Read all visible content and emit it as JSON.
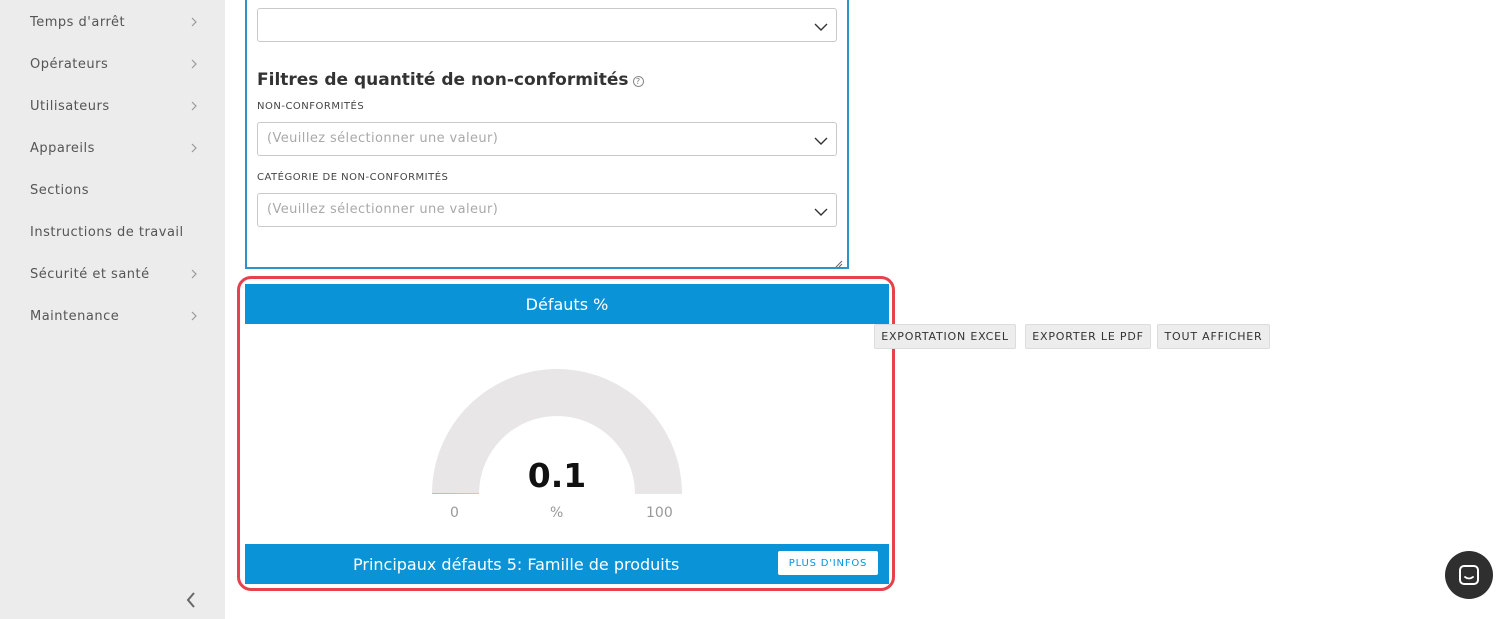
{
  "sidebar": {
    "items": [
      {
        "label": "Temps d'arrêt",
        "chevron": true
      },
      {
        "label": "Opérateurs",
        "chevron": true
      },
      {
        "label": "Utilisateurs",
        "chevron": true
      },
      {
        "label": "Appareils",
        "chevron": true
      },
      {
        "label": "Sections",
        "chevron": false
      },
      {
        "label": "Instructions de travail",
        "chevron": false
      },
      {
        "label": "Sécurité et santé",
        "chevron": true
      },
      {
        "label": "Maintenance",
        "chevron": true
      }
    ],
    "collapse_icon": "chevron-left-icon"
  },
  "filters": {
    "top_select_value": "",
    "section_title": "Filtres de quantité de non-conformités",
    "help_icon": "question-circle-icon",
    "help_glyph": "?",
    "nonconformities_label": "NON-CONFORMITÉS",
    "nonconformities_placeholder": "(Veuillez sélectionner une valeur)",
    "category_label": "CATÉGORIE DE NON-CONFORMITÉS",
    "category_placeholder": "(Veuillez sélectionner une valeur)"
  },
  "widget": {
    "title": "Défauts %",
    "gauge": {
      "value": 0.1,
      "value_text": "0.1",
      "min": "0",
      "max": "100",
      "unit": "%"
    },
    "footer_title": "Principaux défauts 5: Famille de produits",
    "more_button": "PLUS D'INFOS"
  },
  "actions": {
    "export_excel": "EXPORTATION EXCEL",
    "export_pdf": "EXPORTER LE PDF",
    "show_all": "TOUT AFFICHER"
  },
  "colors": {
    "accent": "#0a93d6",
    "highlight": "#e5424d",
    "panel_border": "#2b93c8",
    "gauge_track": "#e8e6e6"
  },
  "chat": {
    "icon": "chat-icon"
  }
}
